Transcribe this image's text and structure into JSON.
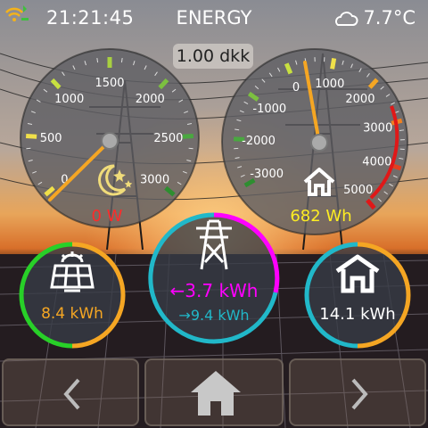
{
  "status_bar": {
    "time": "21:21:45",
    "title": "ENERGY",
    "temperature": "7.7°C",
    "wifi_icon": "wifi-icon",
    "weather_icon": "cloud-icon"
  },
  "price": "1.00 dkk",
  "power_gauge": {
    "ticks": [
      "0",
      "500",
      "1000",
      "1500",
      "2000",
      "2500",
      "3000"
    ],
    "value": "0 W",
    "mode_icon": "moon-stars-icon"
  },
  "energy_gauge": {
    "ticks": [
      "-3000",
      "-2000",
      "-1000",
      "0",
      "1000",
      "2000",
      "3000",
      "4000",
      "5000"
    ],
    "value": "682 Wh",
    "icon": "house-icon"
  },
  "solar": {
    "value": "8.4 kWh",
    "icon": "solar-panel-icon"
  },
  "grid": {
    "import": "←3.7 kWh",
    "export": "→9.4 kWh",
    "icon": "power-pylon-icon"
  },
  "home": {
    "value": "14.1 kWh",
    "icon": "house-icon"
  },
  "nav": {
    "prev_icon": "chevron-left-icon",
    "home_icon": "home-icon",
    "next_icon": "chevron-right-icon"
  },
  "colors": {
    "power_value": "#ff2a2a",
    "energy_value": "#ffee22",
    "solar_value": "#f5a623",
    "grid_import": "#ff00ff",
    "grid_export": "#22bbcc",
    "ring_cyan": "#21b8c9"
  }
}
